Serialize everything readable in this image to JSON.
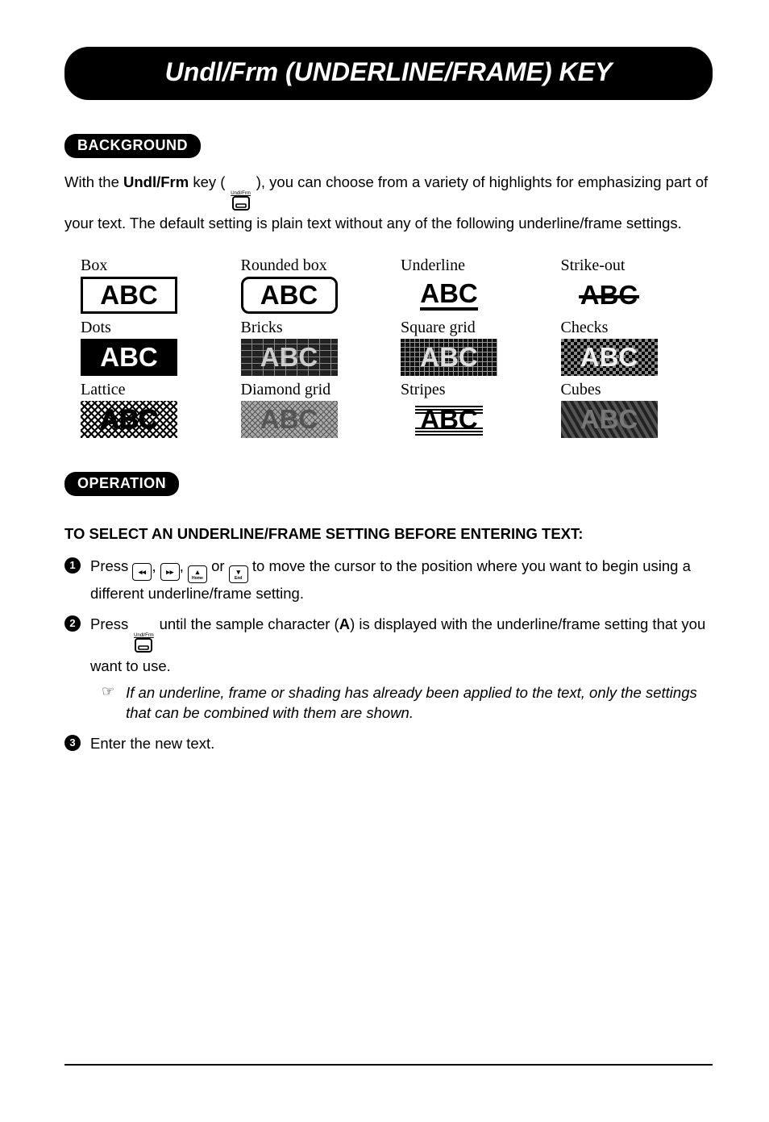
{
  "title": "Undl/Frm (UNDERLINE/FRAME) KEY",
  "sections": {
    "background": {
      "label": "BACKGROUND",
      "para_pre": "With the ",
      "key_name": "Undl/Frm",
      "key_sup": "Undl/Frm",
      "para_mid": " key ( ",
      "para_post": " ), you can choose from a variety of highlights for emphasizing part of your text.  The default setting is plain text without any of the following underline/frame settings."
    },
    "operation": {
      "label": "OPERATION",
      "heading": "TO SELECT AN UNDERLINE/FRAME SETTING BEFORE ENTERING TEXT:",
      "steps": [
        {
          "pre": "Press ",
          "keys": [
            {
              "tri": "◂◂",
              "sub": ""
            },
            {
              "tri": "▸▸",
              "sub": ""
            },
            {
              "tri": "▴",
              "sub": "Home"
            },
            {
              "tri": "▾",
              "sub": "End"
            }
          ],
          "joins": [
            ", ",
            ", ",
            " or "
          ],
          "post": " to move the cursor to the position where you want to begin using a different underline/frame setting."
        },
        {
          "pre": "Press ",
          "frm_key_sup": "Undl/Frm",
          "mid": " until the sample character (",
          "sample_char": "A",
          "post": ") is displayed with the underline/frame setting that you want to use.",
          "note": "If an underline, frame or shading has already been applied to the text, only the settings that can be combined with them are shown."
        },
        {
          "text": "Enter the new text."
        }
      ]
    }
  },
  "samples": [
    {
      "label": "Box",
      "cls": "sw-box",
      "text": "ABC"
    },
    {
      "label": "Rounded box",
      "cls": "sw-rbox",
      "text": "ABC"
    },
    {
      "label": "Underline",
      "cls": "sw-under",
      "text": "ABC"
    },
    {
      "label": "Strike-out",
      "cls": "sw-strike",
      "text": "ABC"
    },
    {
      "label": "Dots",
      "cls": "sw-dark sw-dots",
      "text": "ABC"
    },
    {
      "label": "Bricks",
      "cls": "sw-dark sw-bricks",
      "text": "ABC"
    },
    {
      "label": "Square grid",
      "cls": "sw-dark sw-sqgrid",
      "text": "ABC"
    },
    {
      "label": "Checks",
      "cls": "sw-dark sw-checks",
      "text": "ABC"
    },
    {
      "label": "Lattice",
      "cls": "sw-lattice",
      "text": "ABC"
    },
    {
      "label": "Diamond grid",
      "cls": "sw-dark sw-diamond",
      "text": "ABC"
    },
    {
      "label": "Stripes",
      "cls": "sw-stripes",
      "text": "ABC"
    },
    {
      "label": "Cubes",
      "cls": "sw-dark sw-cubes",
      "text": "ABC"
    }
  ]
}
